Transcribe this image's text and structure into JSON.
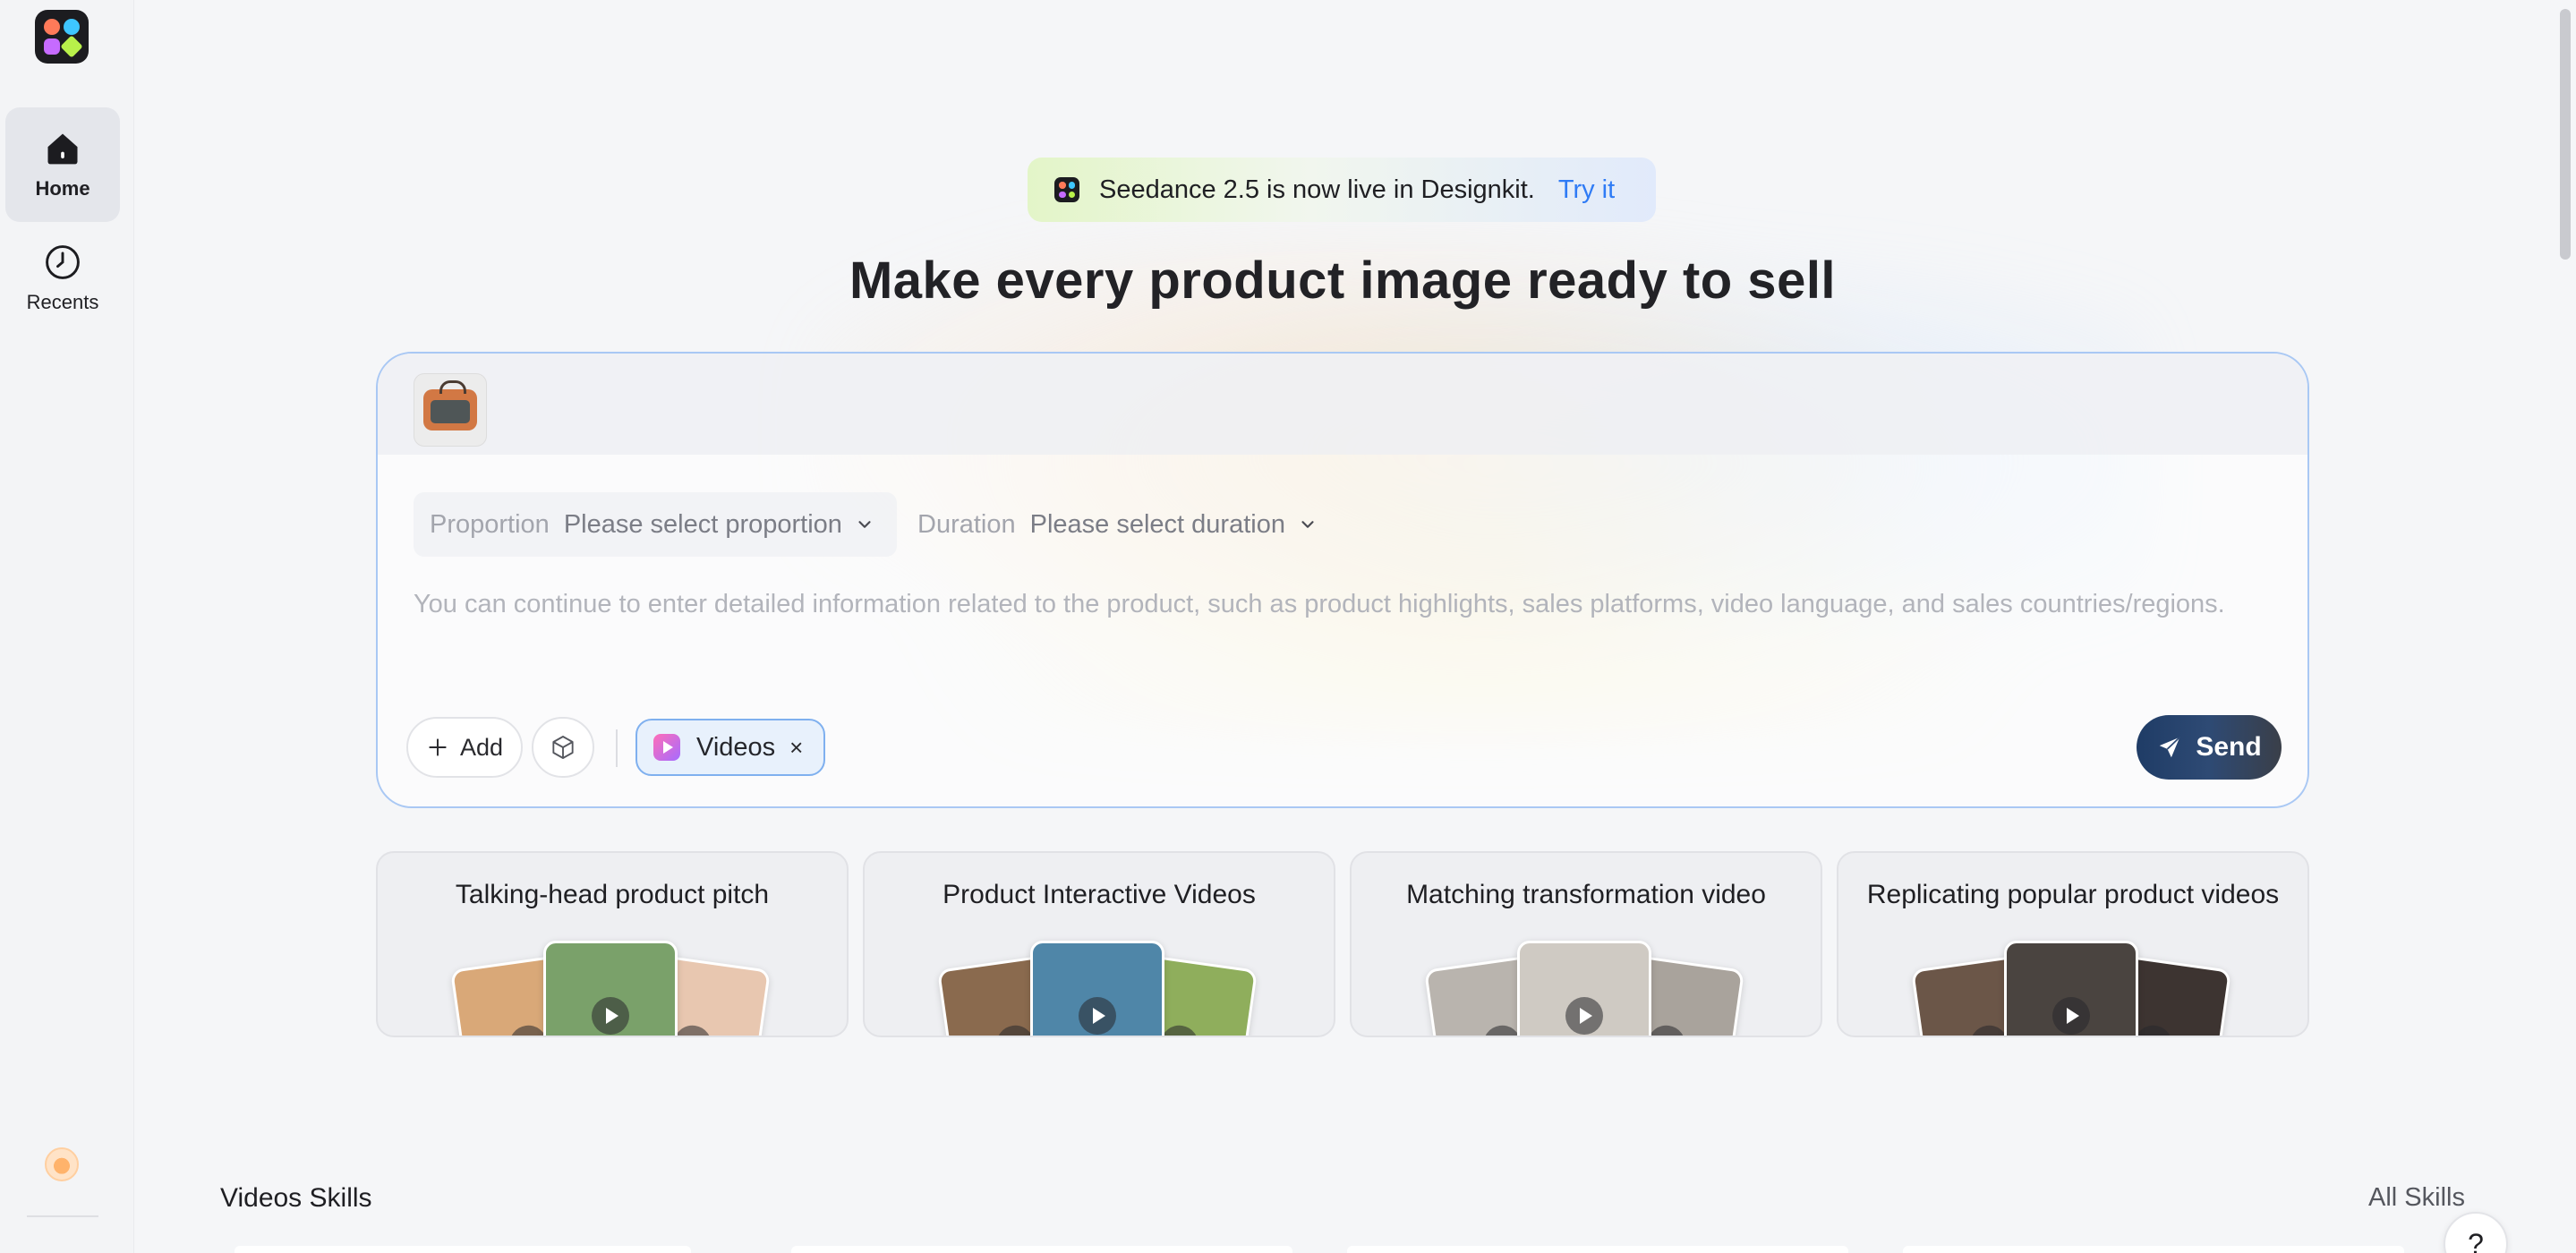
{
  "sidebar": {
    "items": [
      {
        "label": "Home",
        "icon": "home-icon",
        "active": true
      },
      {
        "label": "Recents",
        "icon": "clock-icon",
        "active": false
      }
    ]
  },
  "announcement": {
    "text": "Seedance 2.5 is now live in Designkit.",
    "link": "Try it"
  },
  "headline": "Make every product image ready to sell",
  "composer": {
    "proportion_label": "Proportion",
    "proportion_value": "Please select proportion",
    "duration_label": "Duration",
    "duration_value": "Please select duration",
    "placeholder": "You can continue to enter detailed information related to the product, such as product highlights, sales platforms, video language, and sales countries/regions.",
    "add_label": "Add",
    "chip_label": "Videos",
    "chip_close": "×",
    "send_label": "Send"
  },
  "cards": [
    {
      "title": "Talking-head product pitch",
      "colors": [
        "#d9a878",
        "#7aa16a",
        "#e8c7b0"
      ]
    },
    {
      "title": "Product Interactive Videos",
      "colors": [
        "#8a6a4e",
        "#4f86a8",
        "#8fae5c"
      ]
    },
    {
      "title": "Matching transformation video",
      "colors": [
        "#b9b4ae",
        "#cfcac3",
        "#a9a39c"
      ]
    },
    {
      "title": "Replicating popular product videos",
      "colors": [
        "#6b5648",
        "#4a4440",
        "#3d3431"
      ]
    }
  ],
  "skills": {
    "title": "Videos Skills",
    "all_label": "All Skills"
  },
  "help_label": "?",
  "colors": {
    "accent": "#2f7bf5",
    "composer_border": "#a9c8f4",
    "send_bg": "#1f3c66"
  }
}
